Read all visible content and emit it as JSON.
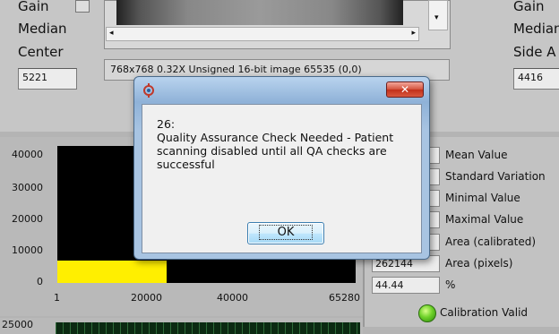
{
  "left_panel": {
    "gain_label": "Gain",
    "median_label": "Median",
    "center_label": "Center",
    "center_value": "5221"
  },
  "right_panel": {
    "gain_label": "Gain",
    "median_label": "Median",
    "side_label": "Side A",
    "side_value": "4416"
  },
  "image_info": "768x768 0.32X Unsigned 16-bit image 65535    (0,0)",
  "histogram": {
    "y_ticks": [
      "40000",
      "30000",
      "20000",
      "10000",
      "0"
    ],
    "x_ticks": [
      "1",
      "20000",
      "40000",
      "65280"
    ]
  },
  "bottom_graph": {
    "y_tick": "25000"
  },
  "stats": {
    "labels": [
      "Mean Value",
      "Standard Variation",
      "Minimal Value",
      "Maximal Value",
      "Area (calibrated)",
      "Area (pixels)",
      "%"
    ],
    "values": [
      "",
      "",
      "",
      "",
      "",
      "262144",
      "44.44"
    ],
    "calibration_label": "Calibration Valid"
  },
  "dialog": {
    "title": "",
    "close_symbol": "✕",
    "message_code": "26:",
    "message": "Quality Assurance Check Needed - Patient scanning disabled until all QA checks are successful",
    "ok_label": "OK"
  },
  "colors": {
    "histogram_fill": "#ffef00",
    "led_green": "#6fd22a",
    "close_red": "#c2301a"
  }
}
